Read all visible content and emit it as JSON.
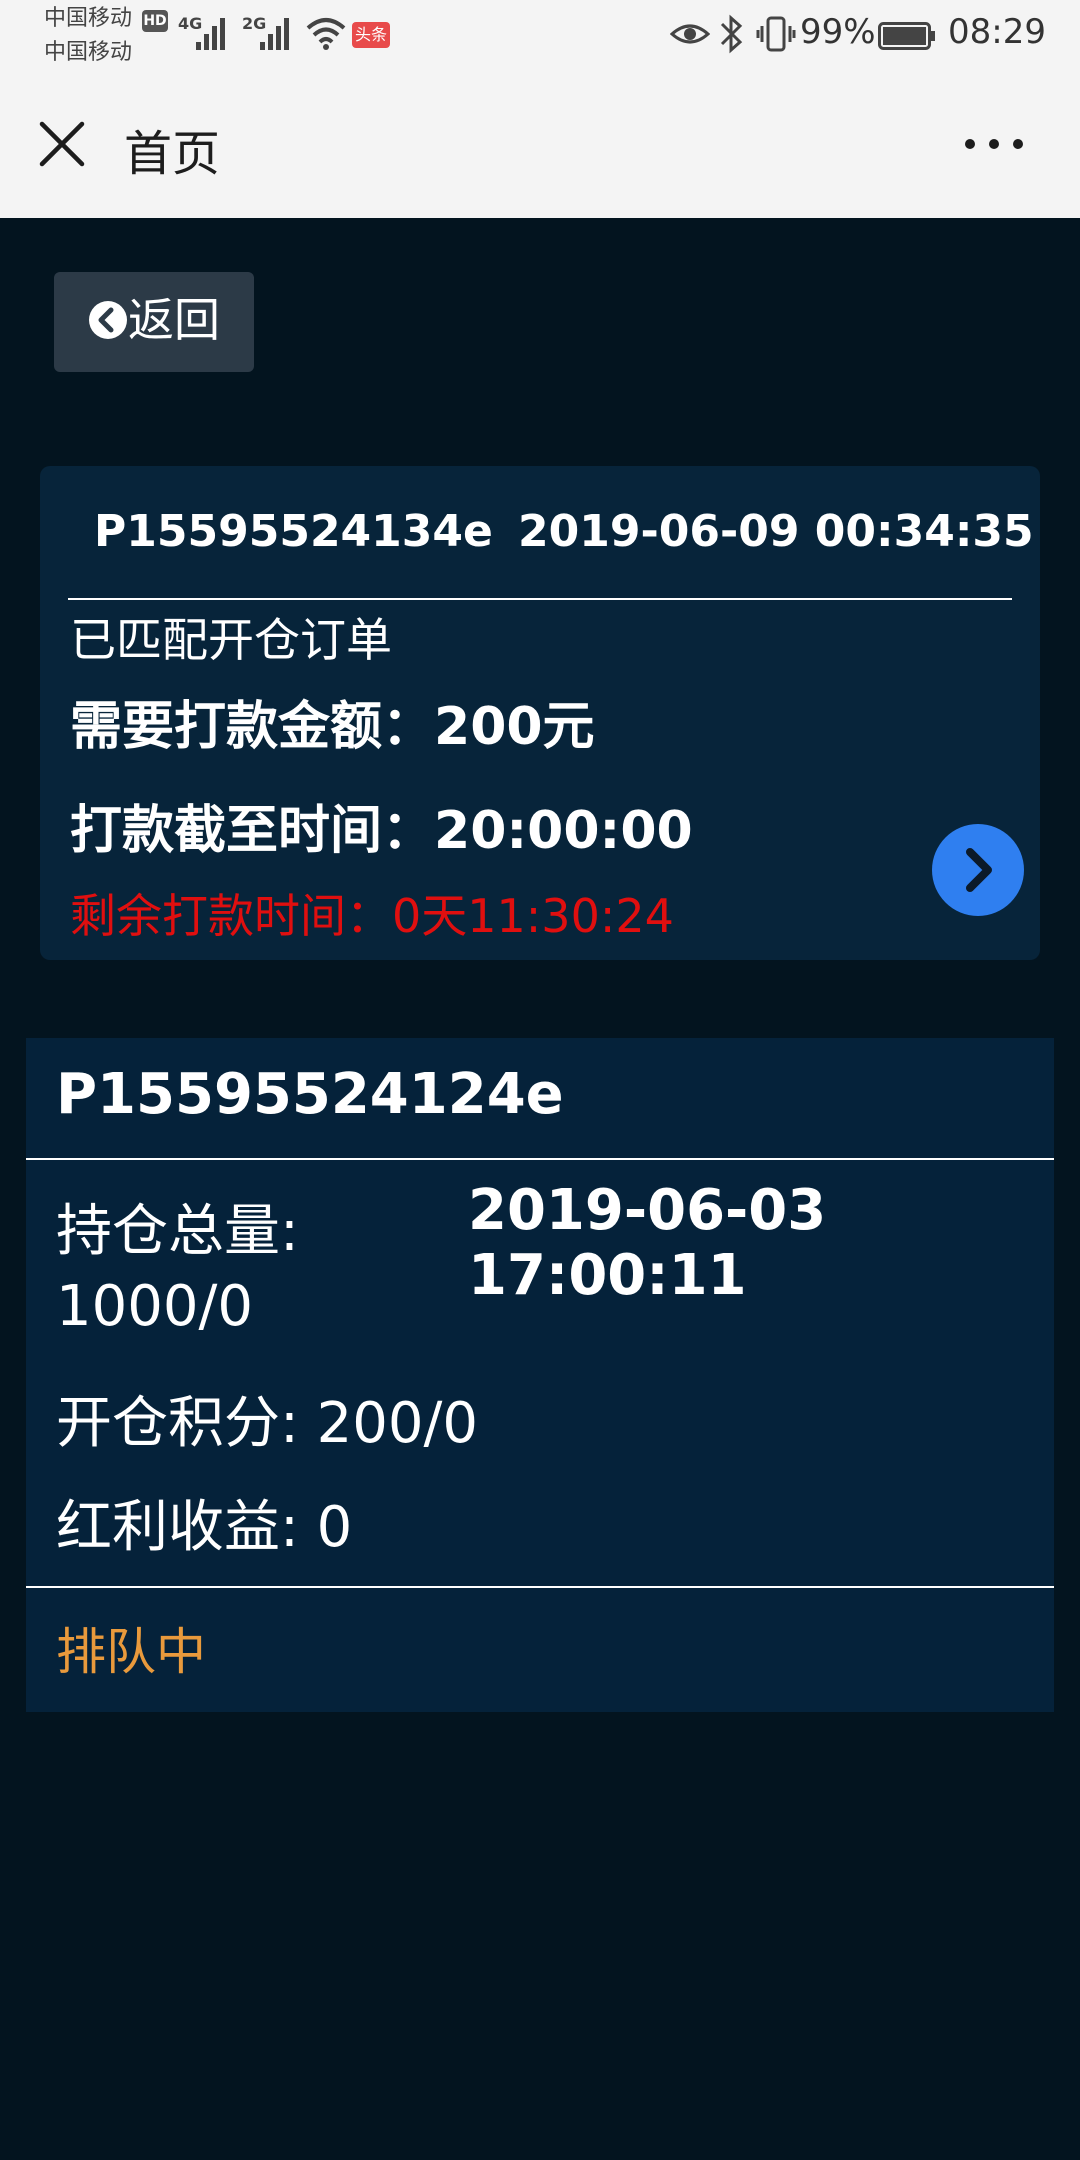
{
  "status_bar": {
    "carrier_1": "中国移动",
    "carrier_2": "中国移动",
    "hd_badge": "HD",
    "net_1": "4G",
    "net_2": "2G",
    "app_badge": "头条",
    "battery_percent": "99%",
    "time": "08:29"
  },
  "title_bar": {
    "title": "首页",
    "close_icon": "close-icon",
    "more_icon": "more-icon"
  },
  "back_button": {
    "label": "返回",
    "icon": "chevron-left-circle-icon"
  },
  "matched_order": {
    "code": "P15595524134e",
    "datetime": "2019-06-09 00:34:35",
    "status": "已匹配开仓订单",
    "amount_label": "需要打款金额：",
    "amount_value": "200元",
    "deadline_label": "打款截至时间：",
    "deadline_value": "20:00:00",
    "remaining_label": "剩余打款时间：",
    "remaining_value": "0天11:30:24",
    "remaining_color": "#e00f0f",
    "go_icon": "chevron-right-circle-icon",
    "go_color": "#2f7ff0"
  },
  "position_card": {
    "code": "P15595524124e",
    "datetime": "2019-06-03 17:00:11",
    "holding_label": "持仓总量:",
    "holding_value": "1000/0",
    "points_text": "开仓积分: 200/0",
    "bonus_text": "红利收益: 0",
    "queue_status": "排队中",
    "queue_color": "#e99a3c"
  },
  "colors": {
    "page_background": "#03141f",
    "card_background": "#07243a",
    "header_background": "#f4f4f4"
  }
}
